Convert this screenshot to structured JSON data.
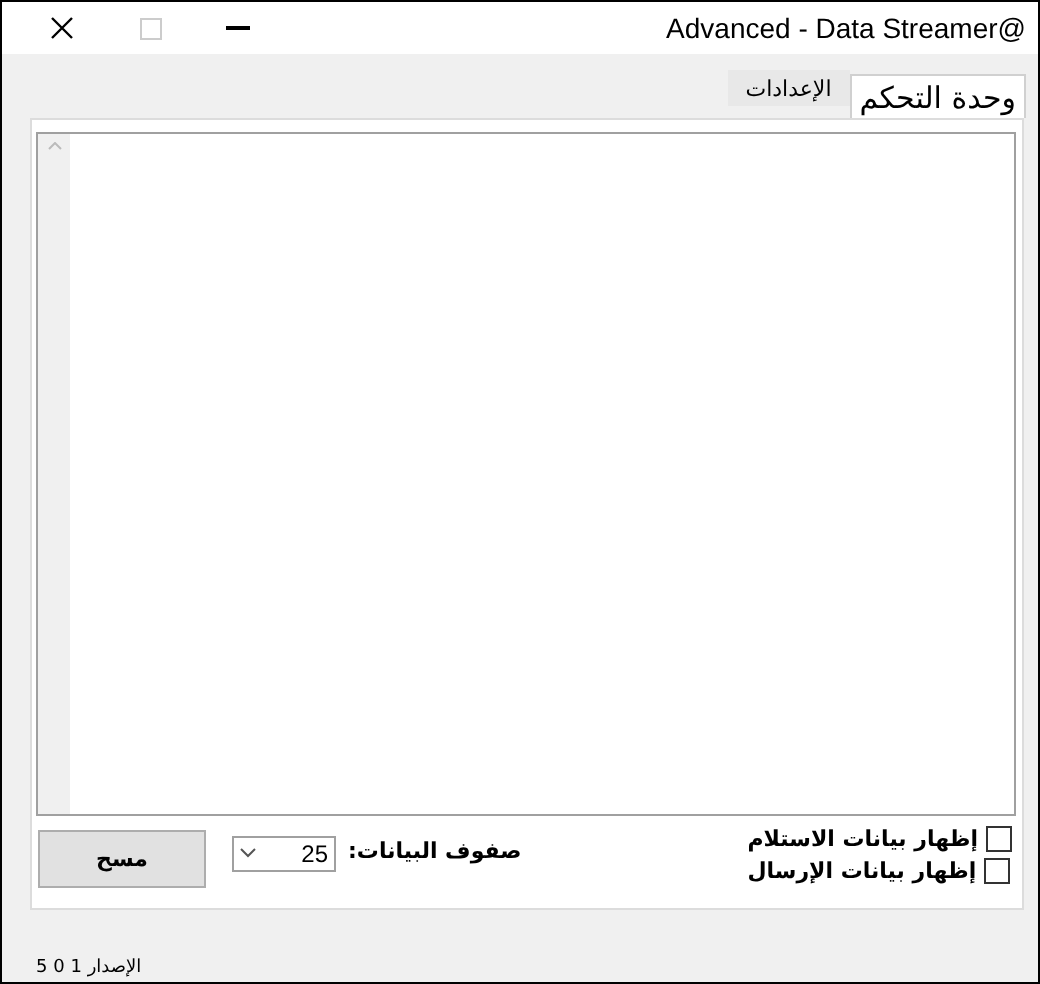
{
  "window": {
    "title": "Advanced - Data Streamer@"
  },
  "tabs": [
    {
      "label": "وحدة التحكم",
      "selected": true
    },
    {
      "label": "الإعدادات",
      "selected": false
    }
  ],
  "controls": {
    "clear_button": "مسح",
    "rows_label": "صفوف البيانات:",
    "rows_value": "25",
    "checkboxes": [
      {
        "label": "إظهار بيانات الاستلام",
        "checked": false
      },
      {
        "label": "إظهار بيانات الإرسال",
        "checked": false
      }
    ]
  },
  "status_bar": {
    "version": "الإصدار 1 0 5"
  }
}
